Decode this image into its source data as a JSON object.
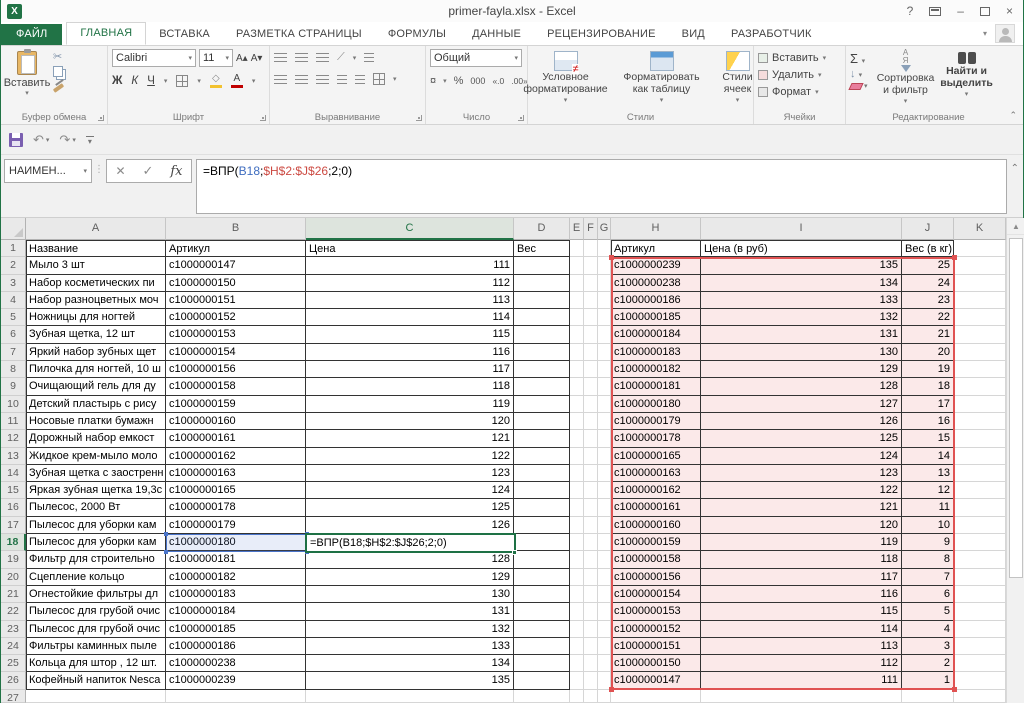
{
  "window": {
    "title": "primer-fayla.xlsx - Excel"
  },
  "icons": {
    "dropdown": "▾",
    "scissors": "✂",
    "sum": "Σ",
    "undo": "↶",
    "redo": "↷",
    "check": "✓",
    "cancel": "✕",
    "fx": "fx",
    "collapse": "⌃",
    "up_arrow": "▲",
    "help": "?",
    "close": "×",
    "minimize": "–",
    "dots": "⋮",
    "down_arrow": "↓",
    "grow_font": "А▴",
    "shrink_font": "А▾",
    "orientation": "⟋",
    "sort_az": "А\nЯ",
    "dec_left": "«.0",
    "dec_right": ".00»",
    "wrap": "↩"
  },
  "tabs": [
    "ФАЙЛ",
    "ГЛАВНАЯ",
    "ВСТАВКА",
    "РАЗМЕТКА СТРАНИЦЫ",
    "ФОРМУЛЫ",
    "ДАННЫЕ",
    "РЕЦЕНЗИРОВАНИЕ",
    "ВИД",
    "РАЗРАБОТЧИК"
  ],
  "ribbon": {
    "groups": [
      "Буфер обмена",
      "Шрифт",
      "Выравнивание",
      "Число",
      "Стили",
      "Ячейки",
      "Редактирование"
    ],
    "paste_label": "Вставить",
    "font": {
      "name": "Calibri",
      "size": "11",
      "bold": "Ж",
      "italic": "К",
      "underline": "Ч"
    },
    "number": {
      "format": "Общий",
      "percent": "%",
      "thousands": "000",
      "currency": "¤"
    },
    "styles": [
      "Условное форматирование",
      "Форматировать как таблицу",
      "Стили ячеек"
    ],
    "cells": [
      "Вставить",
      "Удалить",
      "Формат"
    ],
    "editing": {
      "sort": "Сортировка и фильтр",
      "find": "Найти и выделить"
    }
  },
  "formula_bar": {
    "name_box": "НАИМЕН...",
    "parts": {
      "prefix": "=ВПР(",
      "ref1": "B18",
      "sep": ";",
      "ref2": "$H$2:$J$26",
      "tail": ";2;0)"
    }
  },
  "grid": {
    "columns": [
      "A",
      "B",
      "C",
      "D",
      "E",
      "F",
      "G",
      "H",
      "I",
      "J",
      "K"
    ],
    "selected_column": "C",
    "selected_row": 18,
    "active_cell_formula": "=ВПР(B18;$H$2:$J$26;2;0)",
    "left_table": {
      "headers": [
        "Название",
        "Артикул",
        "Цена",
        "Вес"
      ],
      "rows": [
        {
          "name": "Мыло 3 шт",
          "sku": "c1000000147",
          "price": "111"
        },
        {
          "name": "Набор косметических пи",
          "sku": "c1000000150",
          "price": "112"
        },
        {
          "name": "Набор разноцветных моч",
          "sku": "c1000000151",
          "price": "113"
        },
        {
          "name": "Ножницы для ногтей",
          "sku": "c1000000152",
          "price": "114"
        },
        {
          "name": "Зубная щетка, 12 шт",
          "sku": "c1000000153",
          "price": "115"
        },
        {
          "name": "Яркий набор зубных щет",
          "sku": "c1000000154",
          "price": "116"
        },
        {
          "name": "Пилочка для ногтей, 10 ш",
          "sku": "c1000000156",
          "price": "117"
        },
        {
          "name": "Очищающий гель для ду",
          "sku": "c1000000158",
          "price": "118"
        },
        {
          "name": "Детский пластырь с рису",
          "sku": "c1000000159",
          "price": "119"
        },
        {
          "name": "Носовые платки бумажн",
          "sku": "c1000000160",
          "price": "120"
        },
        {
          "name": "Дорожный набор емкост",
          "sku": "c1000000161",
          "price": "121"
        },
        {
          "name": "Жидкое крем-мыло моло",
          "sku": "c1000000162",
          "price": "122"
        },
        {
          "name": "Зубная щетка с заостренн",
          "sku": "c1000000163",
          "price": "123"
        },
        {
          "name": "Яркая зубная щетка 19,3с",
          "sku": "c1000000165",
          "price": "124"
        },
        {
          "name": "Пылесос, 2000 Вт",
          "sku": "c1000000178",
          "price": "125"
        },
        {
          "name": "Пылесос для уборки кам",
          "sku": "c1000000179",
          "price": "126"
        },
        {
          "name": "Пылесос для уборки кам",
          "sku": "c1000000180",
          "price": "",
          "formula": true
        },
        {
          "name": "Фильтр для строительно",
          "sku": "c1000000181",
          "price": "128"
        },
        {
          "name": "Сцепление кольцо",
          "sku": "c1000000182",
          "price": "129"
        },
        {
          "name": "Огнестойкие фильтры дл",
          "sku": "c1000000183",
          "price": "130"
        },
        {
          "name": "Пылесос для грубой очис",
          "sku": "c1000000184",
          "price": "131"
        },
        {
          "name": "Пылесос для грубой очис",
          "sku": "c1000000185",
          "price": "132"
        },
        {
          "name": "Фильтры каминных пыле",
          "sku": "c1000000186",
          "price": "133"
        },
        {
          "name": "Кольца для штор , 12 шт.",
          "sku": "c1000000238",
          "price": "134"
        },
        {
          "name": "Кофейный напиток Nesca",
          "sku": "c1000000239",
          "price": "135"
        }
      ]
    },
    "right_table": {
      "headers": [
        "Артикул",
        "Цена (в руб)",
        "Вес (в кг)"
      ],
      "rows": [
        {
          "sku": "c1000000239",
          "price": "135",
          "weight": "25"
        },
        {
          "sku": "c1000000238",
          "price": "134",
          "weight": "24"
        },
        {
          "sku": "c1000000186",
          "price": "133",
          "weight": "23"
        },
        {
          "sku": "c1000000185",
          "price": "132",
          "weight": "22"
        },
        {
          "sku": "c1000000184",
          "price": "131",
          "weight": "21"
        },
        {
          "sku": "c1000000183",
          "price": "130",
          "weight": "20"
        },
        {
          "sku": "c1000000182",
          "price": "129",
          "weight": "19"
        },
        {
          "sku": "c1000000181",
          "price": "128",
          "weight": "18"
        },
        {
          "sku": "c1000000180",
          "price": "127",
          "weight": "17"
        },
        {
          "sku": "c1000000179",
          "price": "126",
          "weight": "16"
        },
        {
          "sku": "c1000000178",
          "price": "125",
          "weight": "15"
        },
        {
          "sku": "c1000000165",
          "price": "124",
          "weight": "14"
        },
        {
          "sku": "c1000000163",
          "price": "123",
          "weight": "13"
        },
        {
          "sku": "c1000000162",
          "price": "122",
          "weight": "12"
        },
        {
          "sku": "c1000000161",
          "price": "121",
          "weight": "11"
        },
        {
          "sku": "c1000000160",
          "price": "120",
          "weight": "10"
        },
        {
          "sku": "c1000000159",
          "price": "119",
          "weight": "9"
        },
        {
          "sku": "c1000000158",
          "price": "118",
          "weight": "8"
        },
        {
          "sku": "c1000000156",
          "price": "117",
          "weight": "7"
        },
        {
          "sku": "c1000000154",
          "price": "116",
          "weight": "6"
        },
        {
          "sku": "c1000000153",
          "price": "115",
          "weight": "5"
        },
        {
          "sku": "c1000000152",
          "price": "114",
          "weight": "4"
        },
        {
          "sku": "c1000000151",
          "price": "113",
          "weight": "3"
        },
        {
          "sku": "c1000000150",
          "price": "112",
          "weight": "2"
        },
        {
          "sku": "c1000000147",
          "price": "111",
          "weight": "1"
        }
      ]
    }
  },
  "colors": {
    "accent": "#217346",
    "range_red": "#e05252",
    "range_fill": "#fbe9e9",
    "ref_blue": "#4a74c9"
  }
}
